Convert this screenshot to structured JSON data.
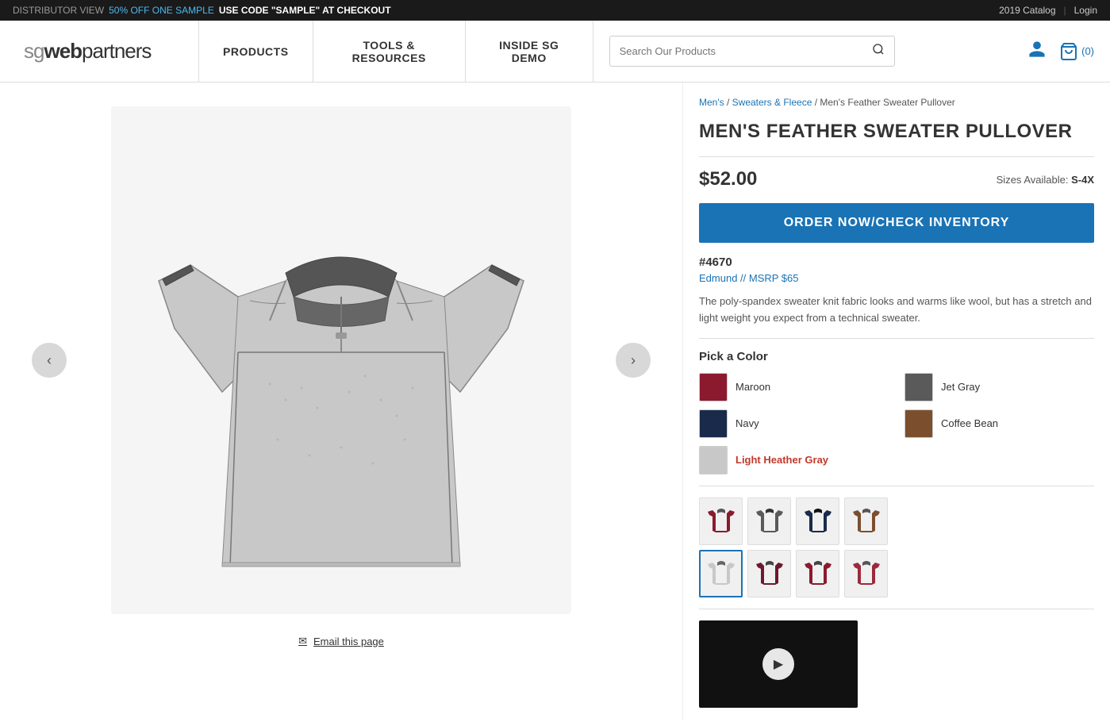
{
  "announcement": {
    "left": {
      "distributor": "DISTRIBUTOR VIEW",
      "off": "50% OFF ONE SAMPLE",
      "code": "USE CODE \"SAMPLE\" AT CHECKOUT"
    },
    "right": {
      "catalog": "2019 Catalog",
      "sep": "|",
      "login": "Login"
    }
  },
  "nav": {
    "logo": "sgwebpartners",
    "logo_sg": "sg",
    "logo_rest": "webpartners",
    "items": [
      {
        "label": "PRODUCTS",
        "id": "products"
      },
      {
        "label": "TOOLS & RESOURCES",
        "id": "tools"
      },
      {
        "label": "INSIDE SG DEMO",
        "id": "inside"
      }
    ],
    "search_placeholder": "Search Our Products",
    "cart_count": "(0)"
  },
  "breadcrumb": {
    "parts": [
      "Men's",
      "Sweaters & Fleece",
      "Men's Feather Sweater Pullover"
    ]
  },
  "product": {
    "title": "MEN'S FEATHER SWEATER PULLOVER",
    "price": "$52.00",
    "sizes_label": "Sizes Available:",
    "sizes_value": "S-4X",
    "order_btn": "ORDER NOW/CHECK INVENTORY",
    "number": "#4670",
    "style_link": "Edmund // MSRP $65",
    "description": "The poly-spandex sweater knit fabric looks and warms like wool, but has a stretch and light weight you expect from a technical sweater.",
    "colors_title": "Pick a Color",
    "colors": [
      {
        "name": "Maroon",
        "hex": "#8B1A2F",
        "selected": false,
        "id": "maroon"
      },
      {
        "name": "Jet Gray",
        "hex": "#5a5a5a",
        "selected": false,
        "id": "jet-gray"
      },
      {
        "name": "Navy",
        "hex": "#1a2a4a",
        "selected": false,
        "id": "navy"
      },
      {
        "name": "Coffee Bean",
        "hex": "#7B4F2E",
        "selected": false,
        "id": "coffee-bean"
      },
      {
        "name": "Light Heather Gray",
        "hex": "#c8c8c8",
        "selected": true,
        "id": "light-heather-gray"
      }
    ],
    "thumbnails_row1_colors": [
      "#8B1A2F",
      "#5a5a5a",
      "#1a2a4a",
      "#7B4F2E"
    ],
    "thumbnails_row2_colors": [
      "#c8c8c8",
      "#6B1A2F",
      "#8B1A2F",
      "#9B2A3F"
    ]
  },
  "email_page": {
    "label": "Email this page",
    "icon": "✉"
  }
}
